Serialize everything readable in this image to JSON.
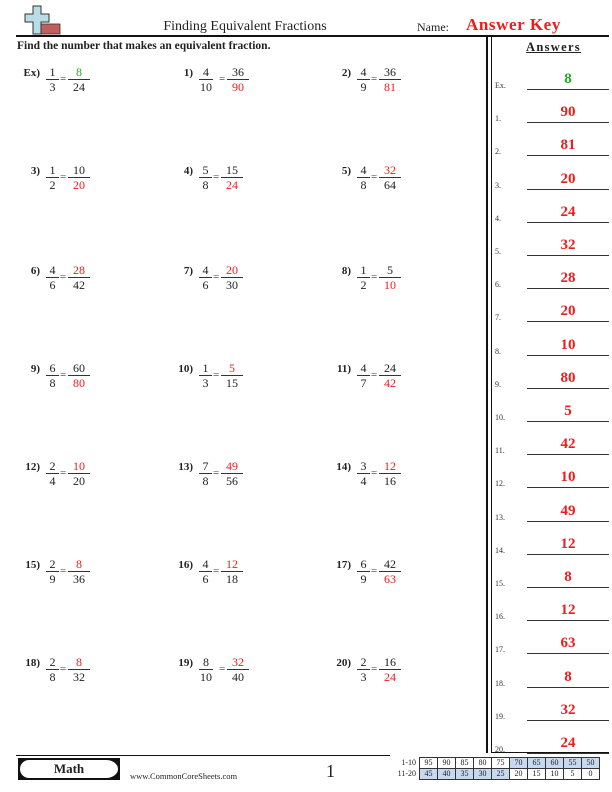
{
  "header": {
    "title": "Finding Equivalent Fractions",
    "name_label": "Name:",
    "name_value": "Answer Key",
    "logo_icon": "plus-sign-logo-icon"
  },
  "instructions": "Find the number that makes an equivalent fraction.",
  "problems": [
    {
      "label": "Ex)",
      "n1": "1",
      "d1": "3",
      "n2": "8",
      "d2": "24",
      "answer_pos": "n2",
      "example": true
    },
    {
      "label": "1)",
      "n1": "4",
      "d1": "10",
      "n2": "36",
      "d2": "90",
      "answer_pos": "d2"
    },
    {
      "label": "2)",
      "n1": "4",
      "d1": "9",
      "n2": "36",
      "d2": "81",
      "answer_pos": "d2"
    },
    {
      "label": "3)",
      "n1": "1",
      "d1": "2",
      "n2": "10",
      "d2": "20",
      "answer_pos": "d2"
    },
    {
      "label": "4)",
      "n1": "5",
      "d1": "8",
      "n2": "15",
      "d2": "24",
      "answer_pos": "d2"
    },
    {
      "label": "5)",
      "n1": "4",
      "d1": "8",
      "n2": "32",
      "d2": "64",
      "answer_pos": "n2"
    },
    {
      "label": "6)",
      "n1": "4",
      "d1": "6",
      "n2": "28",
      "d2": "42",
      "answer_pos": "n2"
    },
    {
      "label": "7)",
      "n1": "4",
      "d1": "6",
      "n2": "20",
      "d2": "30",
      "answer_pos": "n2"
    },
    {
      "label": "8)",
      "n1": "1",
      "d1": "2",
      "n2": "5",
      "d2": "10",
      "answer_pos": "d2"
    },
    {
      "label": "9)",
      "n1": "6",
      "d1": "8",
      "n2": "60",
      "d2": "80",
      "answer_pos": "d2"
    },
    {
      "label": "10)",
      "n1": "1",
      "d1": "3",
      "n2": "5",
      "d2": "15",
      "answer_pos": "n2"
    },
    {
      "label": "11)",
      "n1": "4",
      "d1": "7",
      "n2": "24",
      "d2": "42",
      "answer_pos": "d2"
    },
    {
      "label": "12)",
      "n1": "2",
      "d1": "4",
      "n2": "10",
      "d2": "20",
      "answer_pos": "n2"
    },
    {
      "label": "13)",
      "n1": "7",
      "d1": "8",
      "n2": "49",
      "d2": "56",
      "answer_pos": "n2"
    },
    {
      "label": "14)",
      "n1": "3",
      "d1": "4",
      "n2": "12",
      "d2": "16",
      "answer_pos": "n2"
    },
    {
      "label": "15)",
      "n1": "2",
      "d1": "9",
      "n2": "8",
      "d2": "36",
      "answer_pos": "n2"
    },
    {
      "label": "16)",
      "n1": "4",
      "d1": "6",
      "n2": "12",
      "d2": "18",
      "answer_pos": "n2"
    },
    {
      "label": "17)",
      "n1": "6",
      "d1": "9",
      "n2": "42",
      "d2": "63",
      "answer_pos": "d2"
    },
    {
      "label": "18)",
      "n1": "2",
      "d1": "8",
      "n2": "8",
      "d2": "32",
      "answer_pos": "n2"
    },
    {
      "label": "19)",
      "n1": "8",
      "d1": "10",
      "n2": "32",
      "d2": "40",
      "answer_pos": "n2"
    },
    {
      "label": "20)",
      "n1": "2",
      "d1": "3",
      "n2": "16",
      "d2": "24",
      "answer_pos": "d2"
    }
  ],
  "answers": {
    "title": "Answers",
    "items": [
      {
        "label": "Ex.",
        "value": "8",
        "example": true
      },
      {
        "label": "1.",
        "value": "90"
      },
      {
        "label": "2.",
        "value": "81"
      },
      {
        "label": "3.",
        "value": "20"
      },
      {
        "label": "4.",
        "value": "24"
      },
      {
        "label": "5.",
        "value": "32"
      },
      {
        "label": "6.",
        "value": "28"
      },
      {
        "label": "7.",
        "value": "20"
      },
      {
        "label": "8.",
        "value": "10"
      },
      {
        "label": "9.",
        "value": "80"
      },
      {
        "label": "10.",
        "value": "5"
      },
      {
        "label": "11.",
        "value": "42"
      },
      {
        "label": "12.",
        "value": "10"
      },
      {
        "label": "13.",
        "value": "49"
      },
      {
        "label": "14.",
        "value": "12"
      },
      {
        "label": "15.",
        "value": "8"
      },
      {
        "label": "16.",
        "value": "12"
      },
      {
        "label": "17.",
        "value": "63"
      },
      {
        "label": "18.",
        "value": "8"
      },
      {
        "label": "19.",
        "value": "32"
      },
      {
        "label": "20.",
        "value": "24"
      }
    ]
  },
  "footer": {
    "subject": "Math",
    "website": "www.CommonCoreSheets.com",
    "page_number": "1",
    "score_table": [
      {
        "label": "1-10",
        "values": [
          "95",
          "90",
          "85",
          "80",
          "75",
          "70",
          "65",
          "60",
          "55",
          "50"
        ],
        "highlight": [
          false,
          false,
          false,
          false,
          false,
          true,
          true,
          true,
          true,
          true
        ]
      },
      {
        "label": "11-20",
        "values": [
          "45",
          "40",
          "35",
          "30",
          "25",
          "20",
          "15",
          "10",
          "5",
          "0"
        ],
        "highlight": [
          true,
          true,
          true,
          true,
          true,
          false,
          false,
          false,
          false,
          false
        ]
      }
    ]
  },
  "colors": {
    "answer_red": "#ee1c1c",
    "example_green": "#22aa22",
    "score_highlight": "#c6d9f1"
  }
}
